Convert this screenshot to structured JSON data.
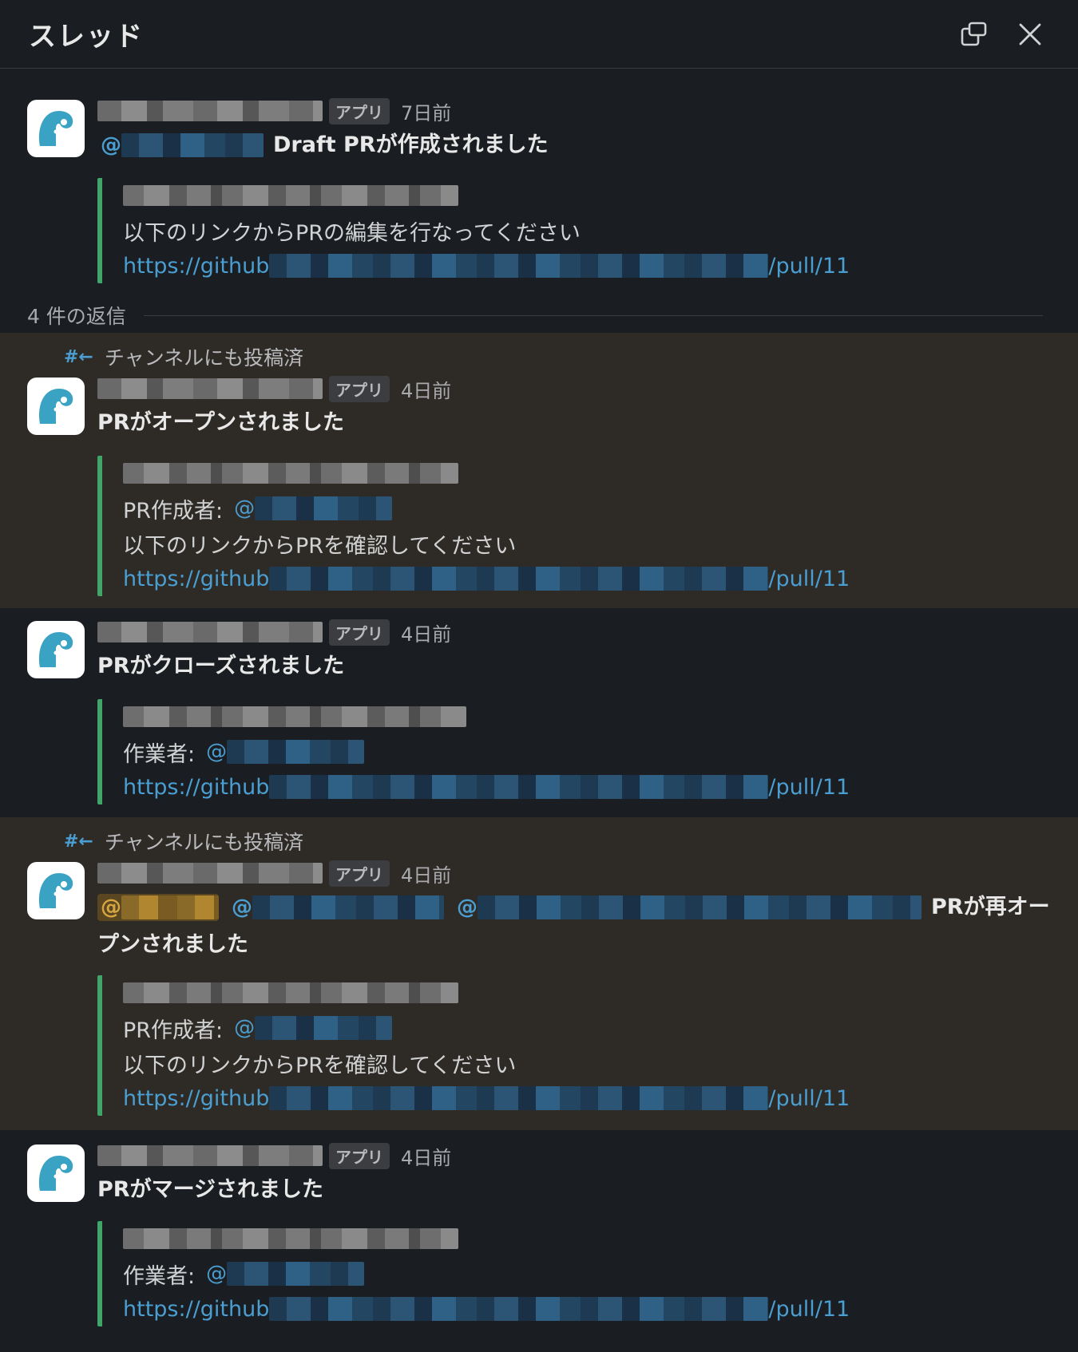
{
  "header": {
    "title": "スレッド"
  },
  "replies_label": "4 件の返信",
  "also_sent_label": "チャンネルにも投稿済",
  "app_badge": "アプリ",
  "messages": [
    {
      "time": "7日前",
      "title": "Draft PRが作成されました",
      "mention_prefix": "@",
      "instruction": "以下のリンクからPRの編集を行なってください",
      "link_start": "https://github",
      "link_end": "/pull/11"
    },
    {
      "time": "4日前",
      "title": "PRがオープンされました",
      "field_label": "PR作成者:",
      "mention_prefix": "@",
      "instruction": "以下のリンクからPRを確認してください",
      "link_start": "https://github",
      "link_end": "/pull/11"
    },
    {
      "time": "4日前",
      "title": "PRがクローズされました",
      "field_label": "作業者:",
      "mention_prefix": "@",
      "link_start": "https://github",
      "link_end": "/pull/11"
    },
    {
      "time": "4日前",
      "title_suffix": "PRが再オー",
      "title_cont": "プンされました",
      "mention_prefix": "@",
      "field_label": "PR作成者:",
      "instruction": "以下のリンクからPRを確認してください",
      "link_start": "https://github",
      "link_end": "/pull/11"
    },
    {
      "time": "4日前",
      "title": "PRがマージされました",
      "field_label": "作業者:",
      "mention_prefix": "@",
      "link_start": "https://github",
      "link_end": "/pull/11"
    }
  ]
}
